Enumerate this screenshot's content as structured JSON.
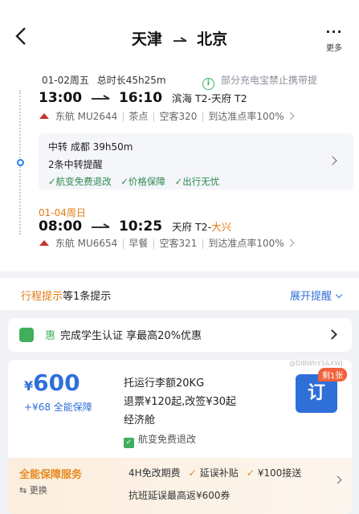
{
  "header": {
    "origin": "天津",
    "destination": "北京",
    "more_label": "更多"
  },
  "summary": {
    "date": "01-02周五",
    "duration": "总时长45h25m",
    "notice": "部分充电宝禁止携带提"
  },
  "segment1": {
    "depart_time": "13:00",
    "arrive_time": "16:10",
    "airports": "滨海 T2-天府 T2",
    "airline": "东航 MU2644",
    "meal": "茶点",
    "aircraft": "空客320",
    "punctuality": "到达准点率100%"
  },
  "transfer": {
    "info": "中转 成都 39h50m",
    "reminders": "2条中转提醒",
    "features": [
      "✓航变免费退改",
      "✓价格保障",
      "✓出行无忧"
    ]
  },
  "segment2": {
    "date": "01-04周日",
    "depart_time": "08:00",
    "arrive_time": "10:25",
    "airports_prefix": "天府 T2-",
    "airports_highlight": "大兴",
    "airline": "东航 MU6654",
    "meal": "早餐",
    "aircraft": "空客321",
    "punctuality": "到达准点率100%"
  },
  "tips": {
    "label": "行程提示",
    "count": "等1条提示",
    "expand": "展开提醒"
  },
  "promo": {
    "tag": "惠",
    "text": "完成学生认证 享最高20%优惠"
  },
  "product": {
    "currency": "¥",
    "price": "600",
    "addon": "+¥68 全能保障",
    "baggage": "托运行李额20KG",
    "policy": "退票¥120起,改签¥30起",
    "cabin": "经济舱",
    "refund_tag": "航变免费退改",
    "book_label": "订",
    "remaining": "剩1张",
    "watermark": "@DIBWhY1&XWJ"
  },
  "service": {
    "title": "全能保障服务",
    "swap": "⇆ 更换",
    "feature1": "4H免改期费",
    "feature2": "延误补贴",
    "feature3": "¥100接送",
    "feature4": "抗班延误最高返¥600券"
  },
  "colors": {
    "accent": "#2f6fd8",
    "warning": "#e07b13",
    "success": "#3fae5d"
  }
}
